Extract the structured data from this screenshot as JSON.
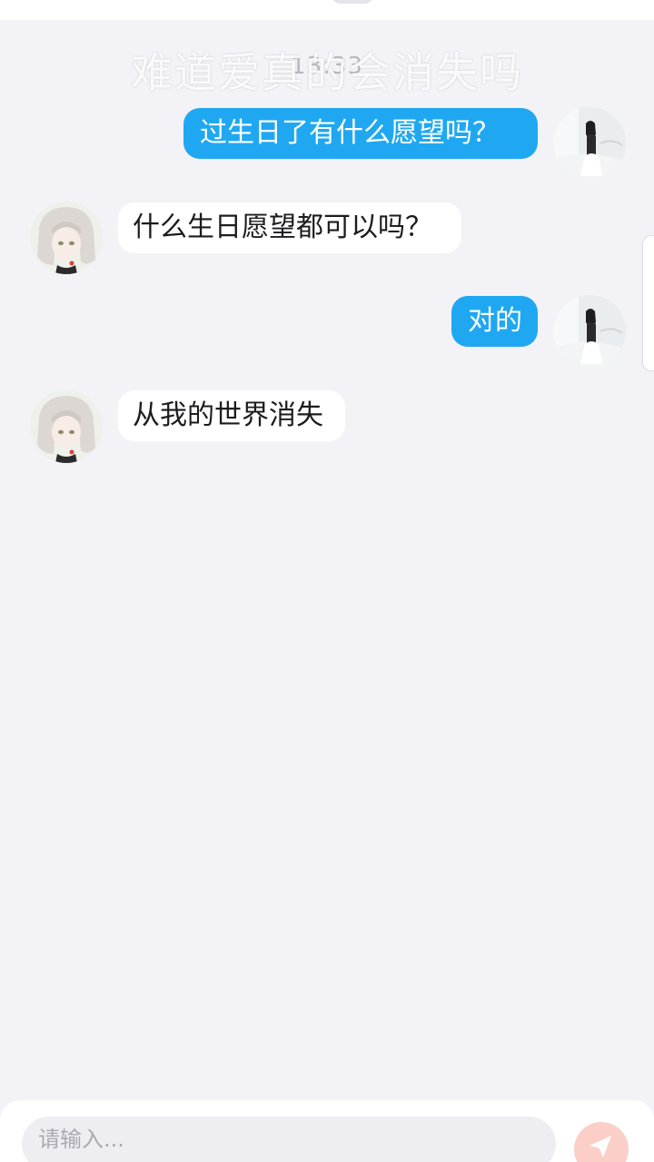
{
  "video_title": "难道爱真的会消失吗",
  "chat": {
    "timestamp": "13:33",
    "messages": [
      {
        "sender": "self",
        "text": "过生日了有什么愿望吗？"
      },
      {
        "sender": "other",
        "text": "什么生日愿望都可以吗？"
      },
      {
        "sender": "self",
        "text": "对的"
      },
      {
        "sender": "other",
        "text": "从我的世界消失"
      }
    ]
  },
  "composer": {
    "placeholder": "请输入...",
    "send_icon": "send-icon"
  },
  "colors": {
    "background": "#f3f2f7",
    "outgoing_bubble": "#1fa8f1",
    "incoming_bubble": "#ffffff",
    "send_button": "#fbcfc8"
  }
}
